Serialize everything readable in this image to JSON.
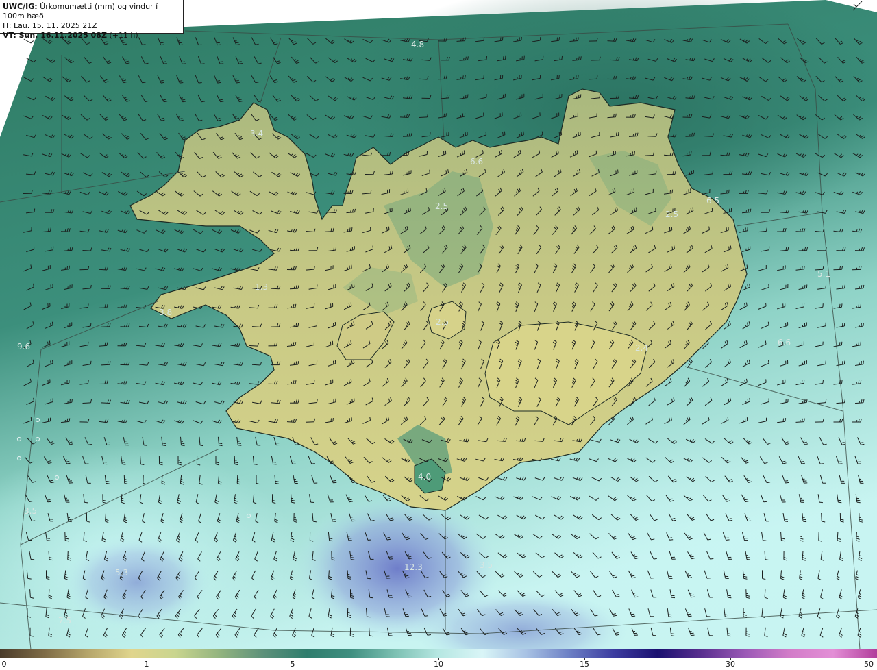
{
  "header": {
    "model": "UWC/IG:",
    "title": " Úrkomumætti (mm) og vindur í 100m hæð",
    "initial_time": "IT: Lau. 15. 11. 2025 21Z",
    "valid_time_label": "VT: Sun. 16.11.2025 08Z",
    "valid_time_offset": " (+11 h)"
  },
  "field_labels": [
    "4.8",
    "3.4",
    "6.6",
    "2.5",
    "6.5",
    "2.5",
    "1.3",
    "3.8",
    "5.1",
    "2.5",
    "6.6",
    "2.4",
    "4.0",
    "12.3",
    "3.5",
    "5.3",
    "9.6",
    "7.5",
    "3.5"
  ],
  "colorbar": {
    "ticks": [
      "0",
      "1",
      "5",
      "10",
      "15",
      "30",
      "50"
    ],
    "colors": [
      "#4a3b2a",
      "#7e6b46",
      "#b5a56a",
      "#e0d58d",
      "#c9d58e",
      "#93b47f",
      "#5d917a",
      "#2f7d6d",
      "#3f8f80",
      "#7cc0b2",
      "#b6e7e2",
      "#d9f5f7",
      "#a8c2e4",
      "#6b7ec4",
      "#3c3ca0",
      "#1a1070",
      "#5a2f8f",
      "#9b59b6",
      "#d27cc8",
      "#e38fd6",
      "#b13d9b"
    ]
  },
  "colors": {
    "ocean_deep": "#2f7a65",
    "ocean_light": "#bff0ee",
    "land_low": "#5e9a72",
    "land_high": "#d9d58c",
    "precip_blue": "#6f7fc9"
  },
  "icons": [
    "wind-barb-icon",
    "coastline-icon"
  ]
}
